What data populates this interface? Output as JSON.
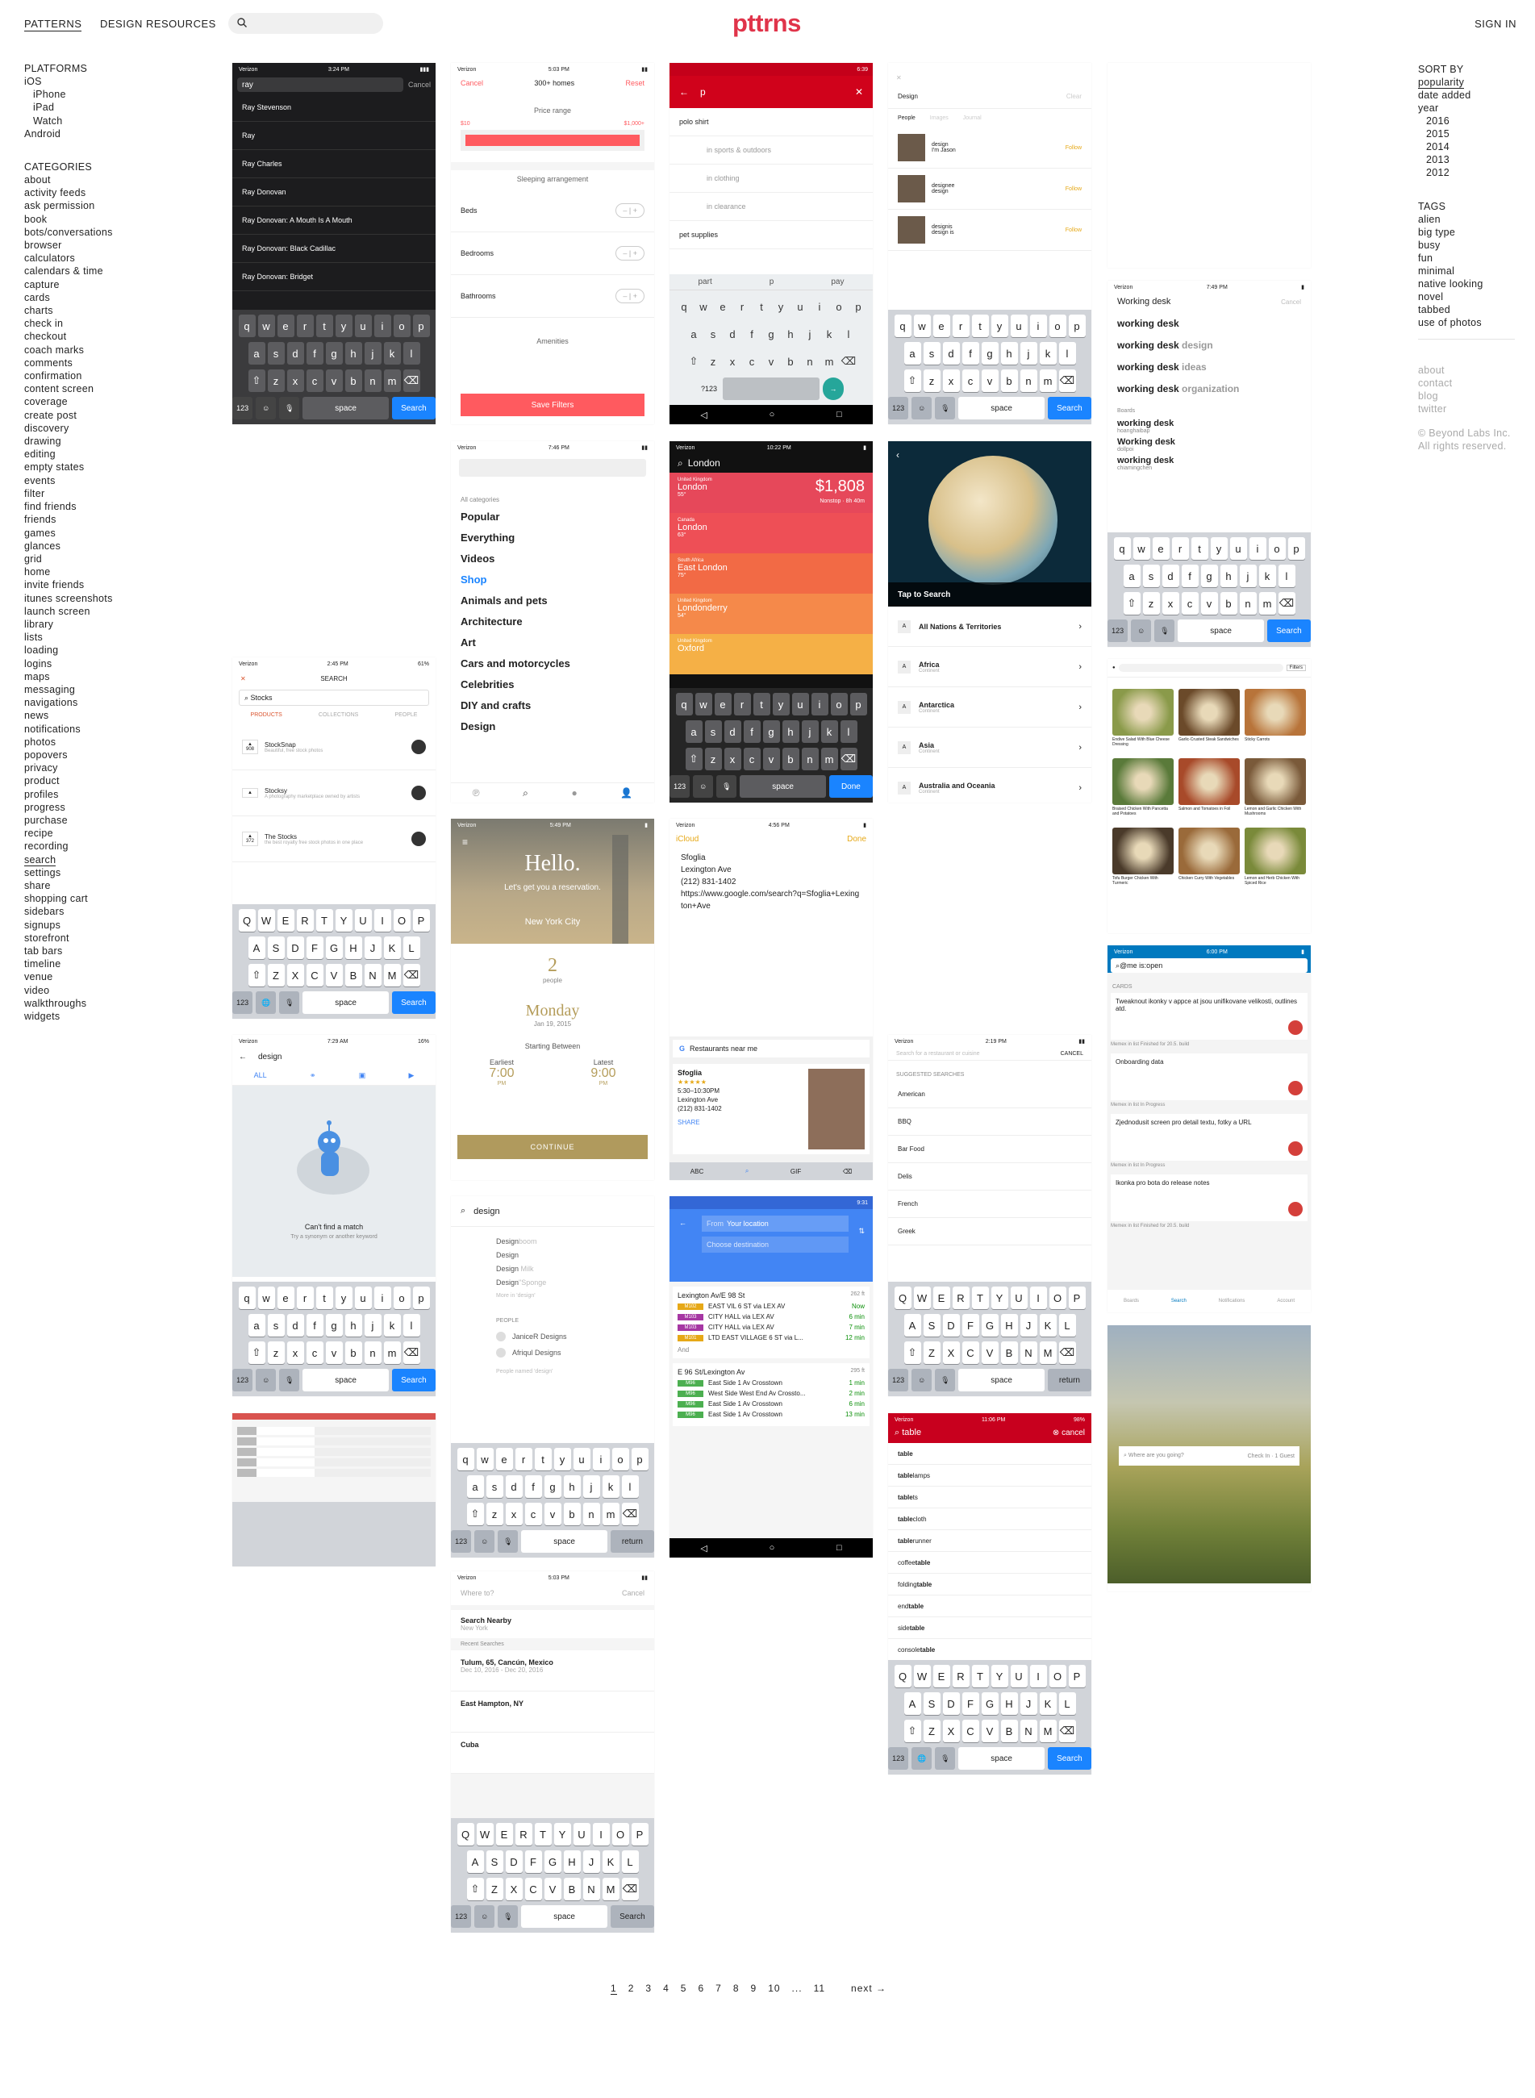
{
  "header": {
    "nav_patterns": "PATTERNS",
    "nav_resources": "DESIGN RESOURCES",
    "logo": "pttrns",
    "sign_in": "SIGN IN"
  },
  "platforms": {
    "heading": "PLATFORMS",
    "ios": "iOS",
    "iphone": "iPhone",
    "ipad": "iPad",
    "watch": "Watch",
    "android": "Android"
  },
  "categories": {
    "heading": "CATEGORIES",
    "items": [
      "about",
      "activity feeds",
      "ask permission",
      "book",
      "bots/conversations",
      "browser",
      "calculators",
      "calendars & time",
      "capture",
      "cards",
      "charts",
      "check in",
      "checkout",
      "coach marks",
      "comments",
      "confirmation",
      "content screen",
      "coverage",
      "create post",
      "discovery",
      "drawing",
      "editing",
      "empty states",
      "events",
      "filter",
      "find friends",
      "friends",
      "games",
      "glances",
      "grid",
      "home",
      "invite friends",
      "itunes screenshots",
      "launch screen",
      "library",
      "lists",
      "loading",
      "logins",
      "maps",
      "messaging",
      "navigations",
      "news",
      "notifications",
      "photos",
      "popovers",
      "privacy",
      "product",
      "profiles",
      "progress",
      "purchase",
      "recipe",
      "recording",
      "search",
      "settings",
      "share",
      "shopping cart",
      "sidebars",
      "signups",
      "storefront",
      "tab bars",
      "timeline",
      "venue",
      "video",
      "walkthroughs",
      "widgets"
    ],
    "current": "search"
  },
  "sort": {
    "heading": "SORT BY",
    "popularity": "popularity",
    "date_added": "date added",
    "year": "year",
    "years": [
      "2016",
      "2015",
      "2014",
      "2013",
      "2012"
    ]
  },
  "tags": {
    "heading": "TAGS",
    "items": [
      "alien",
      "big type",
      "busy",
      "fun",
      "minimal",
      "native looking",
      "novel",
      "tabbed",
      "use of photos"
    ]
  },
  "footer_links": [
    "about",
    "contact",
    "blog",
    "twitter"
  ],
  "copyright": "© Beyond Labs Inc.",
  "rights": "All rights reserved.",
  "pagination": {
    "pages": [
      "1",
      "2",
      "3",
      "4",
      "5",
      "6",
      "7",
      "8",
      "9",
      "10",
      "...",
      "11"
    ],
    "next": "next →"
  },
  "colors": {
    "brand": "#e0344a",
    "ios_blue": "#1a84ff",
    "android_red": "#d0021b"
  },
  "screens": {
    "s1": {
      "carrier": "Verizon",
      "time": "3:24 PM",
      "query": "ray",
      "cancel": "Cancel",
      "results": [
        "Ray Stevenson",
        "Ray",
        "Ray Charles",
        "Ray Donovan",
        "Ray Donovan: A Mouth Is A Mouth",
        "Ray Donovan: Black Cadillac",
        "Ray Donovan: Bridget"
      ],
      "space": "space",
      "go": "Search",
      "num": "123"
    },
    "s2": {
      "carrier": "Verizon",
      "time": "5:03 PM",
      "cancel": "Cancel",
      "title": "300+ homes",
      "reset": "Reset",
      "price_range": "Price range",
      "min": "$10",
      "max": "$1,000+",
      "sleeping": "Sleeping arrangement",
      "beds": "Beds",
      "bedrooms": "Bedrooms",
      "bathrooms": "Bathrooms",
      "amenities": "Amenities",
      "save": "Save Filters"
    },
    "s3": {
      "time": "6:39",
      "query": "p",
      "suggestions": [
        "polo shirt",
        "in sports & outdoors",
        "in clothing",
        "in clearance",
        "pet supplies"
      ],
      "predict": [
        "part",
        "p",
        "pay"
      ],
      "sym": "?123"
    },
    "s4": {
      "title": "Design",
      "clear": "Clear",
      "tabs": [
        "People",
        "Images",
        "Journal"
      ],
      "people": [
        {
          "name": "design",
          "sub": "I'm Jason",
          "btn": "Follow"
        },
        {
          "name": "designee",
          "sub": "design",
          "btn": "Follow"
        },
        {
          "name": "designis",
          "sub": "design is",
          "btn": "Follow"
        }
      ],
      "space": "space",
      "go": "Search",
      "num": "123"
    },
    "s5": {
      "carrier": "Verizon",
      "time": "7:49 PM",
      "query": "Working desk",
      "cancel": "Cancel",
      "suggest": [
        [
          "working desk",
          ""
        ],
        [
          "working desk",
          " design"
        ],
        [
          "working desk",
          " ideas"
        ],
        [
          "working desk",
          " organization"
        ]
      ],
      "boards": "Boards",
      "board_items": [
        [
          "working desk",
          "hoanghaibap"
        ],
        [
          "Working desk",
          "dollpoi"
        ],
        [
          "working desk",
          "chiamingchen"
        ]
      ],
      "space": "space",
      "go": "Search",
      "num": "123"
    },
    "s6": {
      "carrier": "Verizon",
      "time": "7:46 PM",
      "all": "All categories",
      "cats": [
        "Popular",
        "Everything",
        "Videos",
        "Shop",
        "Animals and pets",
        "Architecture",
        "Art",
        "Cars and motorcycles",
        "Celebrities",
        "DIY and crafts",
        "Design"
      ]
    },
    "s7": {
      "carrier": "Verizon",
      "time": "10:22 PM",
      "query": "London",
      "cards": [
        {
          "country": "United Kingdom",
          "city": "London",
          "temp": "55°",
          "price": "$1,808",
          "sub": "Nonstop · 8h 40m"
        },
        {
          "country": "Canada",
          "city": "London",
          "temp": "63°"
        },
        {
          "country": "South Africa",
          "city": "East London",
          "temp": "75°"
        },
        {
          "country": "United Kingdom",
          "city": "Londonderry",
          "temp": "54°"
        },
        {
          "country": "United Kingdom",
          "city": "Oxford",
          "temp": ""
        }
      ],
      "space": "space",
      "done": "Done",
      "num": "123"
    },
    "s8": {
      "tap": "Tap to Search",
      "regions": [
        [
          "All Nations & Territories",
          ""
        ],
        [
          "Africa",
          "Continent"
        ],
        [
          "Antarctica",
          "Continent"
        ],
        [
          "Asia",
          "Continent"
        ],
        [
          "Australia and Oceania",
          "Continent"
        ]
      ]
    },
    "s9": {
      "carrier": "Verizon",
      "time": "2:45 PM",
      "battery": "61%",
      "title": "SEARCH",
      "query": "Stocks",
      "tabs": [
        "PRODUCTS",
        "COLLECTIONS",
        "PEOPLE"
      ],
      "items": [
        {
          "votes": "908",
          "name": "StockSnap",
          "desc": "Beautiful, free stock photos"
        },
        {
          "votes": "",
          "name": "Stocksy",
          "desc": "A photography marketplace owned by artists"
        },
        {
          "votes": "372",
          "name": "The Stocks",
          "desc": "the best royalty free stock photos in one place"
        }
      ],
      "space": "space",
      "go": "Search",
      "num": "123"
    },
    "s10": {
      "carrier": "Verizon",
      "time": "5:49 PM",
      "hello": "Hello.",
      "sub": "Let's get you a reservation.",
      "city": "New York City",
      "people_n": "2",
      "people": "people",
      "day": "Monday",
      "date": "Jan 19, 2015",
      "starting": "Starting Between",
      "earliest": "Earliest",
      "latest": "Latest",
      "e_time": "7:00",
      "l_time": "9:00",
      "pm": "PM",
      "continue": "CONTINUE"
    },
    "s11": {
      "carrier": "Verizon",
      "time": "4:56 PM",
      "back": "iCloud",
      "done": "Done",
      "place": "Sfoglia",
      "addr": "Lexington Ave",
      "phone": "(212) 831-1402",
      "url": "https://www.google.com/search?q=Sfoglia+Lexington+Ave",
      "gsearch": "Restaurants near me",
      "card_name": "Sfoglia",
      "card_hours": "5:30–10:30PM",
      "card_addr": "Lexington Ave",
      "card_phone": "(212) 831-1402",
      "share": "SHARE",
      "kb": [
        "ABC",
        "GIF"
      ]
    },
    "s12": {
      "carrier": "Verizon",
      "time": "6:00 PM",
      "query": "@me is:open",
      "cards": "CARDS",
      "items": [
        {
          "title": "Tweaknout ikonky v appce at jsou unifikovane velikosti, outlines atd.",
          "list": "Memex in list Finished for 20.5. build"
        },
        {
          "title": "Onboarding data",
          "list": "Memex in list In Progress"
        },
        {
          "title": "Zjednodusit screen pro detail textu, fotky a URL",
          "list": "Memex in list In Progress"
        },
        {
          "title": "Ikonka pro bota do release notes",
          "list": "Memex in list Finished for 20.5. build"
        }
      ],
      "tabs": [
        "Boards",
        "Search",
        "Notifications",
        "Account"
      ]
    },
    "s13": {
      "carrier": "Verizon",
      "time": "7:29 AM",
      "battery": "16%",
      "query": "design",
      "all": "ALL",
      "nomatch": "Can't find a match",
      "hint": "Try a synonym or another keyword",
      "space": "space",
      "go": "Search",
      "num": "123"
    },
    "s14": {
      "query": "design",
      "suggest": [
        [
          "Design",
          "boom"
        ],
        [
          "Design",
          ""
        ],
        [
          "Design",
          " Milk"
        ],
        [
          "Design",
          "\"Sponge"
        ]
      ],
      "more": "More in 'design'",
      "people_h": "PEOPLE",
      "people": [
        "JaniceR Designs",
        "Afriqul Designs"
      ],
      "named": "People named 'design'",
      "space": "space",
      "ret": "return",
      "num": "123"
    },
    "s15": {
      "time": "9:31",
      "from": "From",
      "from_val": "Your location",
      "dest": "Choose destination",
      "stop1": "Lexington Av/E 98 St",
      "dist1": "262 ft",
      "routes1": [
        [
          "M102",
          "EAST VIL 6 ST via LEX AV",
          "Now",
          "#e6a817"
        ],
        [
          "M103",
          "CITY HALL via LEX AV",
          "6 min",
          "#a637a3"
        ],
        [
          "M103",
          "CITY HALL via LEX AV",
          "7 min",
          "#a637a3"
        ],
        [
          "M101",
          "LTD EAST VILLAGE 6 ST via L...",
          "12 min",
          "#e6a817"
        ]
      ],
      "and": "And",
      "stop2": "E 96 St/Lexington Av",
      "dist2": "295 ft",
      "routes2": [
        [
          "M96",
          "East Side 1 Av Crosstown",
          "1 min",
          "#4caf50"
        ],
        [
          "M96",
          "West Side West End Av Crossto...",
          "2 min",
          "#4caf50"
        ],
        [
          "M96",
          "East Side 1 Av Crosstown",
          "6 min",
          "#4caf50"
        ],
        [
          "M96",
          "East Side 1 Av Crosstown",
          "13 min",
          "#4caf50"
        ]
      ]
    },
    "s16": {
      "carrier": "Verizon",
      "time": "2:19 PM",
      "placeholder": "Search for a restaurant or cuisine",
      "cancel": "CANCEL",
      "suggested": "SUGGESTED SEARCHES",
      "items": [
        "American",
        "BBQ",
        "Bar Food",
        "Delis",
        "French",
        "Greek"
      ],
      "space": "space",
      "ret": "return",
      "num": "123"
    },
    "s17": {
      "carrier": "Verizon",
      "time": "11:06 PM",
      "battery": "98%",
      "query": "table",
      "cancel": "cancel",
      "items": [
        [
          "table",
          ""
        ],
        [
          "table",
          " lamps"
        ],
        [
          "table",
          "ts"
        ],
        [
          "table",
          "cloth"
        ],
        [
          "table",
          " runner"
        ],
        [
          "coffee ",
          "table"
        ],
        [
          "folding ",
          "table"
        ],
        [
          "end ",
          "table"
        ],
        [
          "side ",
          "table"
        ],
        [
          "console ",
          "table"
        ]
      ],
      "space": "space",
      "go": "Search",
      "num": "123"
    },
    "s18": {
      "placeholder": "Where are you going?",
      "checkin": "Check In",
      "guest": "1 Guest"
    },
    "s19": {
      "carrier": "Verizon",
      "time": "5:03 PM",
      "placeholder": "Where to?",
      "cancel": "Cancel",
      "nearby": "Search Nearby",
      "nearby_sub": "New York",
      "recent": "Recent Searches",
      "items": [
        [
          "Tulum, 65, Cancún, Mexico",
          "Dec 10, 2016 - Dec 20, 2016"
        ],
        [
          "East Hampton, NY",
          ""
        ],
        [
          "Cuba",
          ""
        ]
      ],
      "space": "space",
      "go": "Search",
      "num": "123"
    },
    "s20": {
      "query": "Where are you going?",
      "recipes": [
        "Endive Salad With Blue Cheese Dressing",
        "Garlic-Crusted Steak Sandwiches",
        "Sticky Carrots",
        "Braised Chicken With Pancetta and Potatoes",
        "Salmon and Tomatoes in Foil",
        "Lemon and Garlic Chicken With Mushrooms",
        "Tofu Burger Chicken With Turmeric",
        "Chicken Curry With Vegetables",
        "Lemon and Herb Chicken With Spiced Rice"
      ],
      "filter": "Filters"
    }
  }
}
